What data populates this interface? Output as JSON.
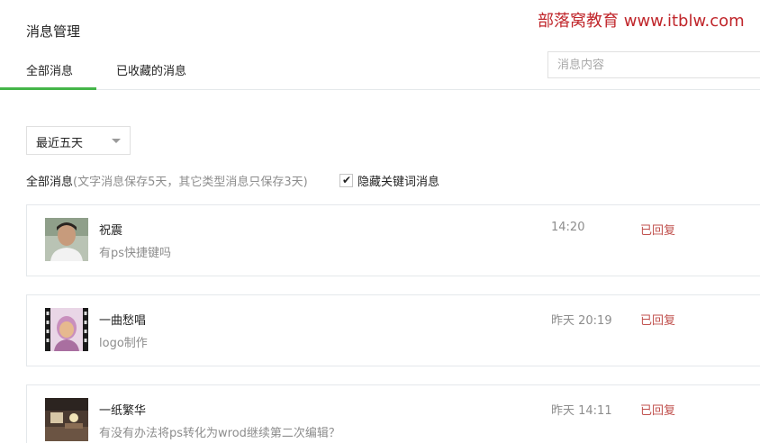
{
  "header": {
    "title": "消息管理",
    "watermark": "部落窝教育 www.itblw.com"
  },
  "tabs": [
    {
      "label": "全部消息",
      "active": true
    },
    {
      "label": "已收藏的消息",
      "active": false
    }
  ],
  "search": {
    "placeholder": "消息内容",
    "value": ""
  },
  "filter": {
    "range_selected": "最近五天",
    "summary_label": "全部消息",
    "summary_note": "(文字消息保存5天，其它类型消息只保存3天)",
    "hide_keyword_label": "隐藏关键词消息",
    "hide_keyword_checked": true
  },
  "messages": [
    {
      "name": "祝震",
      "text": "有ps快捷键吗",
      "time": "14:20",
      "status": "已回复",
      "avatar": "avatar-photo-man"
    },
    {
      "name": "一曲愁唱",
      "text": "logo制作",
      "time": "昨天 20:19",
      "status": "已回复",
      "avatar": "avatar-photo-film"
    },
    {
      "name": "一纸繁华",
      "text": "有没有办法将ps转化为wrod继续第二次编辑？",
      "time": "昨天 14:11",
      "status": "已回复",
      "avatar": "avatar-photo-room"
    }
  ],
  "colors": {
    "accent_green": "#44b549",
    "status_red": "#c0504d",
    "watermark_red": "#c0262b"
  }
}
